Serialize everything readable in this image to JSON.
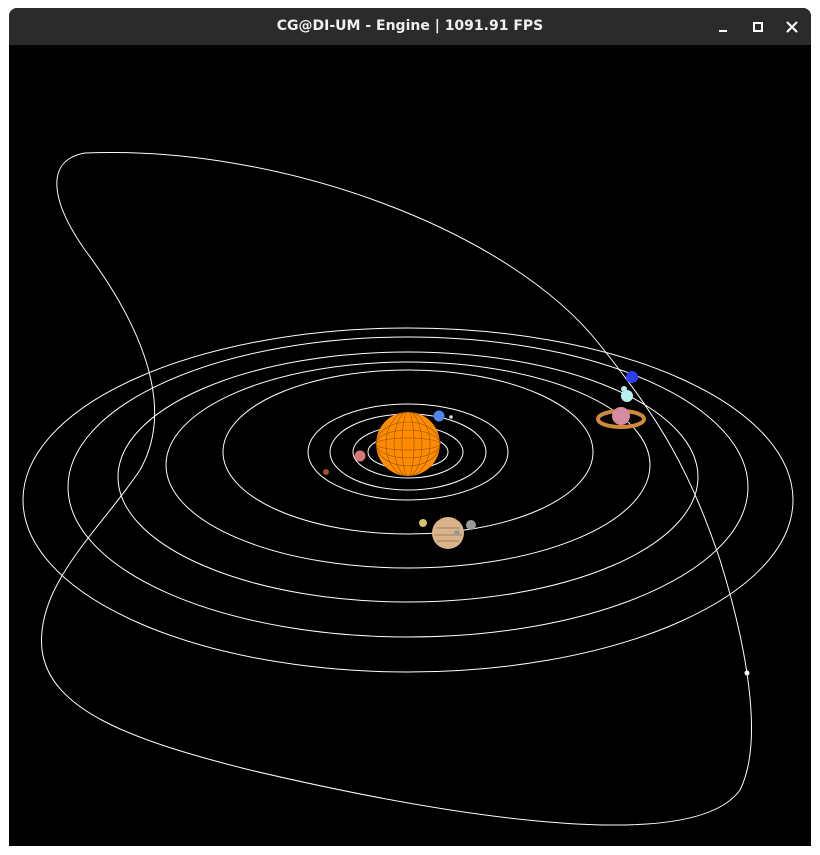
{
  "window": {
    "title": "CG@DI-UM - Engine | 1091.91 FPS"
  },
  "controls": {
    "icons": [
      "minimize-icon",
      "maximize-icon",
      "close-icon"
    ]
  },
  "scene": {
    "background": "#000000",
    "orbit_color": "#ffffff",
    "sun_color": "#ff8c00",
    "bodies": [
      "sun",
      "mercury",
      "venus",
      "earth",
      "moon",
      "mars",
      "jupiter",
      "saturn",
      "uranus",
      "neptune",
      "comet"
    ],
    "colors": {
      "mercury": "#a0522d",
      "venus": "#d9777a",
      "earth": "#4f86e8",
      "jupiter": "#d9b48a",
      "saturn": "#d68ca0",
      "saturn_ring": "#d2883a",
      "uranus": "#b8f0f0",
      "neptune": "#2c3ef0",
      "comet": "#ffffff"
    }
  }
}
